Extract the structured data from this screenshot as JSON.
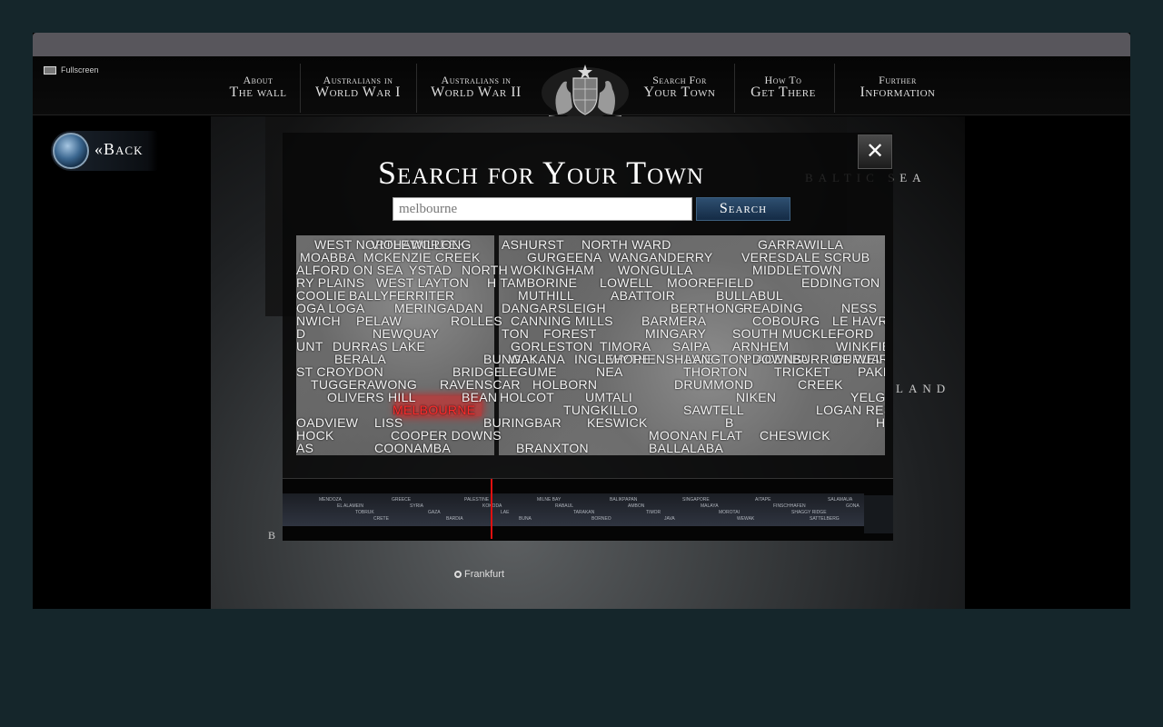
{
  "window": {
    "fullscreen_label": "Fullscreen"
  },
  "nav": {
    "items": [
      {
        "line1": "About",
        "line2": "The wall"
      },
      {
        "line1": "Australians in",
        "line2": "World War I"
      },
      {
        "line1": "Australians in",
        "line2": "World War II"
      },
      {
        "line1": "Search For",
        "line2": "Your Town"
      },
      {
        "line1": "How To",
        "line2": "Get There"
      },
      {
        "line1": "Further",
        "line2": "Information"
      }
    ]
  },
  "back": {
    "label": "«Back"
  },
  "map": {
    "labels": {
      "sea": "Baltic  Sea",
      "land": "land",
      "frankfurt": "Frankfurt",
      "edge": "B"
    }
  },
  "search": {
    "title": "Search for Your Town",
    "input_value": "melbourne",
    "button_label": "Search",
    "close_label": "✕"
  },
  "wall_names": [
    "WEST NORTHAM",
    "VIOLET CREEK",
    "WILLONG",
    "MOABBA",
    "MCKENZIE CREEK",
    "ALFORD ON SEA",
    "YSTAD",
    "NORTH",
    "RY PLAINS",
    "WEST LAYTON",
    "COOLIE",
    "BALLYFERRITER",
    "OGA LOGA",
    "MERINGADAN",
    "NWICH",
    "PELAW",
    "ROLLES",
    "D",
    "NEWQUAY",
    "UNT",
    "DURRAS LAKE",
    "BERALA",
    "BUNGAY",
    "ST CROYDON",
    "BRIDGE",
    "TUGGERAWONG",
    "RAVENSCAR",
    "OLIVERS HILL",
    "BEAN",
    "MELBOURNE",
    "OADVIEW",
    "LISS",
    "BURINGBAR",
    "HOCK",
    "COOPER DOWNS",
    "AS",
    "COONAMBA",
    "ASHURST",
    "NORTH WARD",
    "GARRAWILLA",
    "GURGEENA",
    "WANGANDERRY",
    "VERESDALE SCRUB",
    "WOKINGHAM",
    "WONGULLA",
    "MIDDLETOWN",
    "H TAMBORINE",
    "LOWELL",
    "MOOREFIELD",
    "EDDINGTON",
    "MUTHILL",
    "ABATTOIR",
    "BULLABUL",
    "DANGARSLEIGH",
    "BERTHONG",
    "READING",
    "NESS",
    "CANNING MILLS",
    "BARMERA",
    "COBOURG",
    "LE HAVR",
    "TON",
    "FOREST",
    "MINGARY",
    "SOUTH MUCKLEFORD",
    "GORLESTON",
    "TIMORA",
    "SAIPA",
    "ARNHEM",
    "WINKFIELD",
    "WAKANA",
    "WYTHENSHAWE",
    "PIACENZA",
    "BURUA",
    "INGLEHOPE",
    "LANGTON DOWNS",
    "BURRUN",
    "OF WEIR",
    "LEGUME",
    "NEA",
    "THORTON",
    "TRICKET",
    "PAKENHAM UPPER",
    "HOLBORN",
    "DRUMMOND",
    "CREEK",
    "HOLCOT",
    "UMTALI",
    "NIKEN",
    "YELGUN",
    "TUNGKILLO",
    "SAWTELL",
    "LOGAN RESERVE",
    "KESWICK",
    "B",
    "HOYA",
    "MOONAN FLAT",
    "CHESWICK",
    "BRANXTON",
    "BALLALABA"
  ],
  "timeline": {
    "labels": [
      "MENDOZA",
      "EL ALAMEIN",
      "TOBRUK",
      "CRETE",
      "GREECE",
      "SYRIA",
      "GAZA",
      "BARDIA",
      "PALESTINE",
      "KOKODA",
      "LAE",
      "BUNA",
      "MILNE BAY",
      "RABAUL",
      "TARAKAN",
      "BORNEO",
      "BALIKPAPAN",
      "AMBON",
      "TIMOR",
      "JAVA",
      "SINGAPORE",
      "MALAYA",
      "MOROTAI",
      "WEWAK",
      "AITAPE",
      "FINSCHHAFEN",
      "SHAGGY RIDGE",
      "SATTELBERG",
      "SALAMAUA",
      "GONA"
    ]
  },
  "colors": {
    "page_bg": "#15262b",
    "title_bar": "#58565c",
    "search_button": "#1f3a58",
    "highlight": "#ff2b2b"
  }
}
